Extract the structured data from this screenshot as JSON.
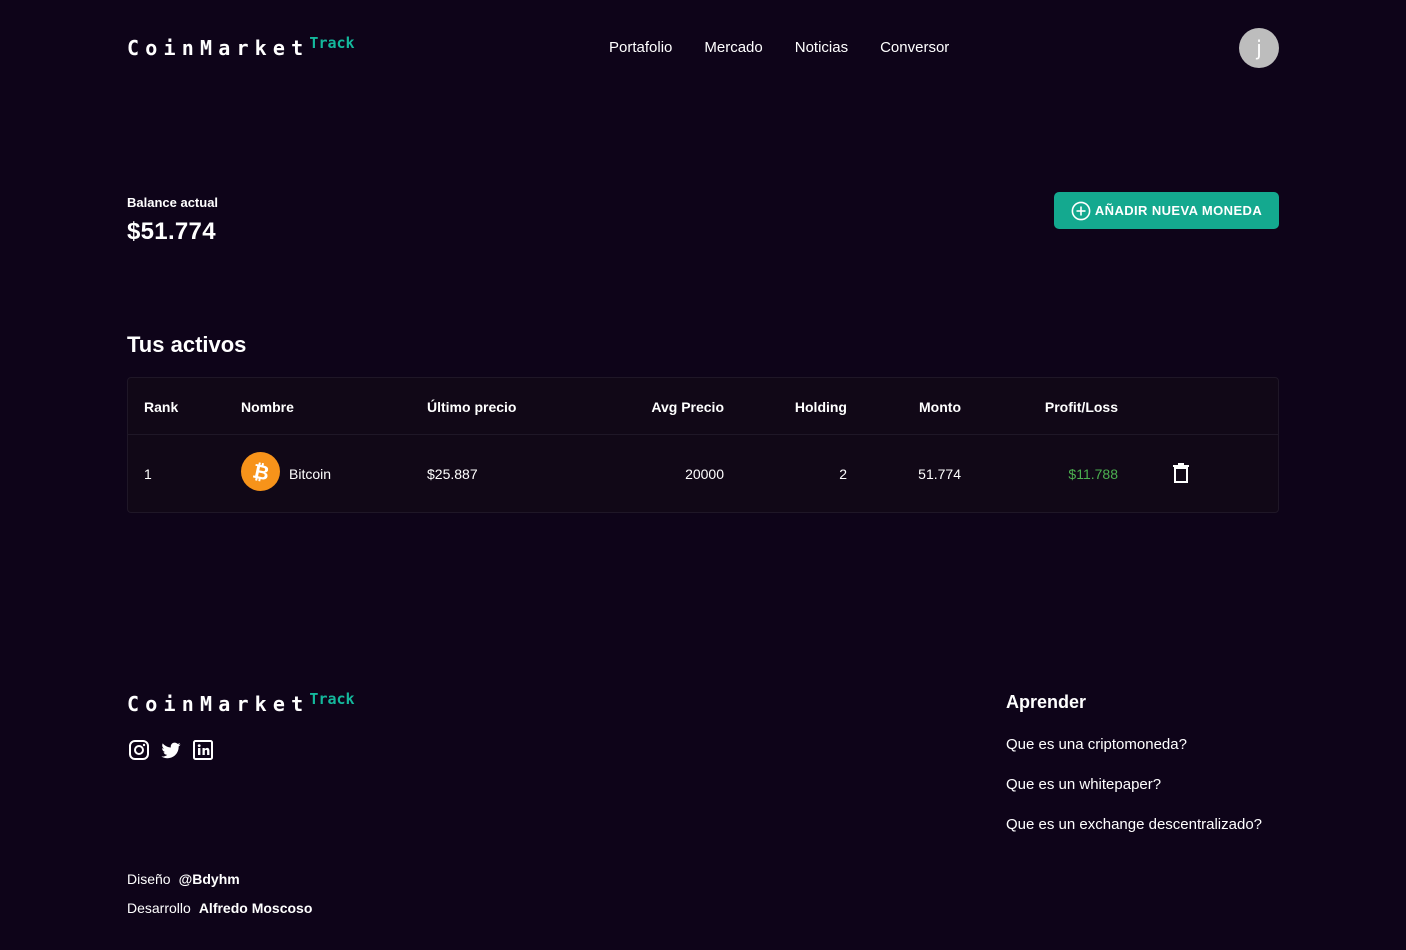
{
  "header": {
    "logo_main": "CoinMarket",
    "logo_sub": "Track",
    "nav": [
      "Portafolio",
      "Mercado",
      "Noticias",
      "Conversor"
    ],
    "avatar_letter": "j"
  },
  "balance": {
    "label": "Balance actual",
    "value": "$51.774"
  },
  "add_button": {
    "label": "AÑADIR NUEVA MONEDA",
    "icon": "plus-circle-icon",
    "color": "#14a98f"
  },
  "assets": {
    "title": "Tus activos",
    "columns": [
      "Rank",
      "Nombre",
      "Último precio",
      "Avg Precio",
      "Holding",
      "Monto",
      "Profit/Loss"
    ],
    "rows": [
      {
        "rank": "1",
        "name": "Bitcoin",
        "icon": "bitcoin-icon",
        "last_price": "$25.887",
        "avg_price": "20000",
        "holding": "2",
        "amount": "51.774",
        "profit_loss": "$11.788",
        "profit_color": "#4caf50"
      }
    ]
  },
  "footer": {
    "logo_main": "CoinMarket",
    "logo_sub": "Track",
    "socials": [
      "instagram-icon",
      "twitter-icon",
      "linkedin-icon"
    ],
    "learn": {
      "title": "Aprender",
      "links": [
        "Que es una criptomoneda?",
        "Que es un whitepaper?",
        "Que es un exchange descentralizado?"
      ]
    },
    "credits": [
      {
        "label": "Diseño",
        "value": "@Bdyhm"
      },
      {
        "label": "Desarrollo",
        "value": "Alfredo Moscoso"
      }
    ]
  },
  "colors": {
    "background": "#0e0419",
    "accent": "#14b89c",
    "bitcoin": "#f7931a"
  }
}
